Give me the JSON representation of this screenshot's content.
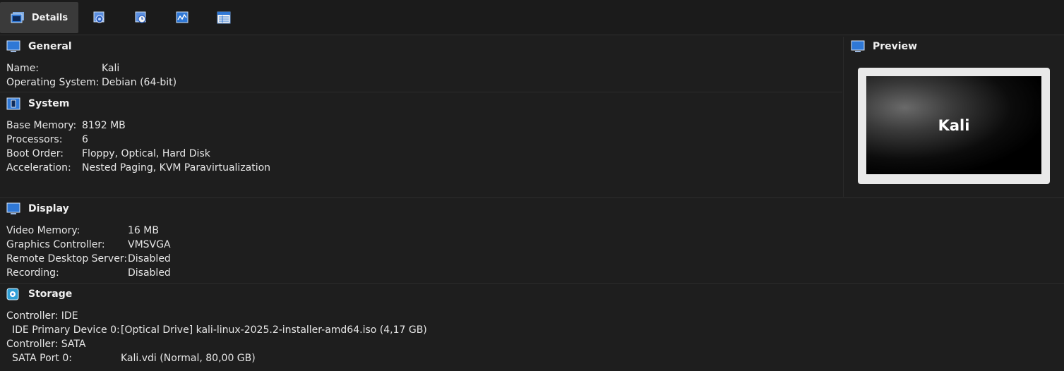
{
  "toolbar": {
    "details_label": "Details",
    "tabs": [
      {
        "icon": "snapshots-icon"
      },
      {
        "icon": "logs-icon"
      },
      {
        "icon": "activity-icon"
      },
      {
        "icon": "properties-icon"
      }
    ]
  },
  "general": {
    "title": "General",
    "rows": [
      {
        "label": "Name:",
        "value": "Kali"
      },
      {
        "label": "Operating System:",
        "value": "Debian (64-bit)"
      }
    ]
  },
  "system": {
    "title": "System",
    "rows": [
      {
        "label": "Base Memory:",
        "value": "8192 MB"
      },
      {
        "label": "Processors:",
        "value": "6"
      },
      {
        "label": "Boot Order:",
        "value": "Floppy, Optical, Hard Disk"
      },
      {
        "label": "Acceleration:",
        "value": "Nested Paging, KVM Paravirtualization"
      }
    ]
  },
  "preview": {
    "title": "Preview",
    "screen_text": "Kali"
  },
  "display": {
    "title": "Display",
    "rows": [
      {
        "label": "Video Memory:",
        "value": "16 MB"
      },
      {
        "label": "Graphics Controller:",
        "value": "VMSVGA"
      },
      {
        "label": "Remote Desktop Server:",
        "value": "Disabled"
      },
      {
        "label": "Recording:",
        "value": "Disabled"
      }
    ]
  },
  "storage": {
    "title": "Storage",
    "rows": [
      {
        "label": "Controller: IDE",
        "value": ""
      },
      {
        "label": "IDE Primary Device 0:",
        "value": "[Optical Drive] kali-linux-2025.2-installer-amd64.iso (4,17 GB)"
      },
      {
        "label": "Controller: SATA",
        "value": ""
      },
      {
        "label": "SATA Port 0:",
        "value": "Kali.vdi (Normal, 80,00 GB)"
      }
    ]
  },
  "colors": {
    "background": "#1e1e1e",
    "icon_blue": "#2f78d6",
    "text": "#e6e6e6"
  }
}
